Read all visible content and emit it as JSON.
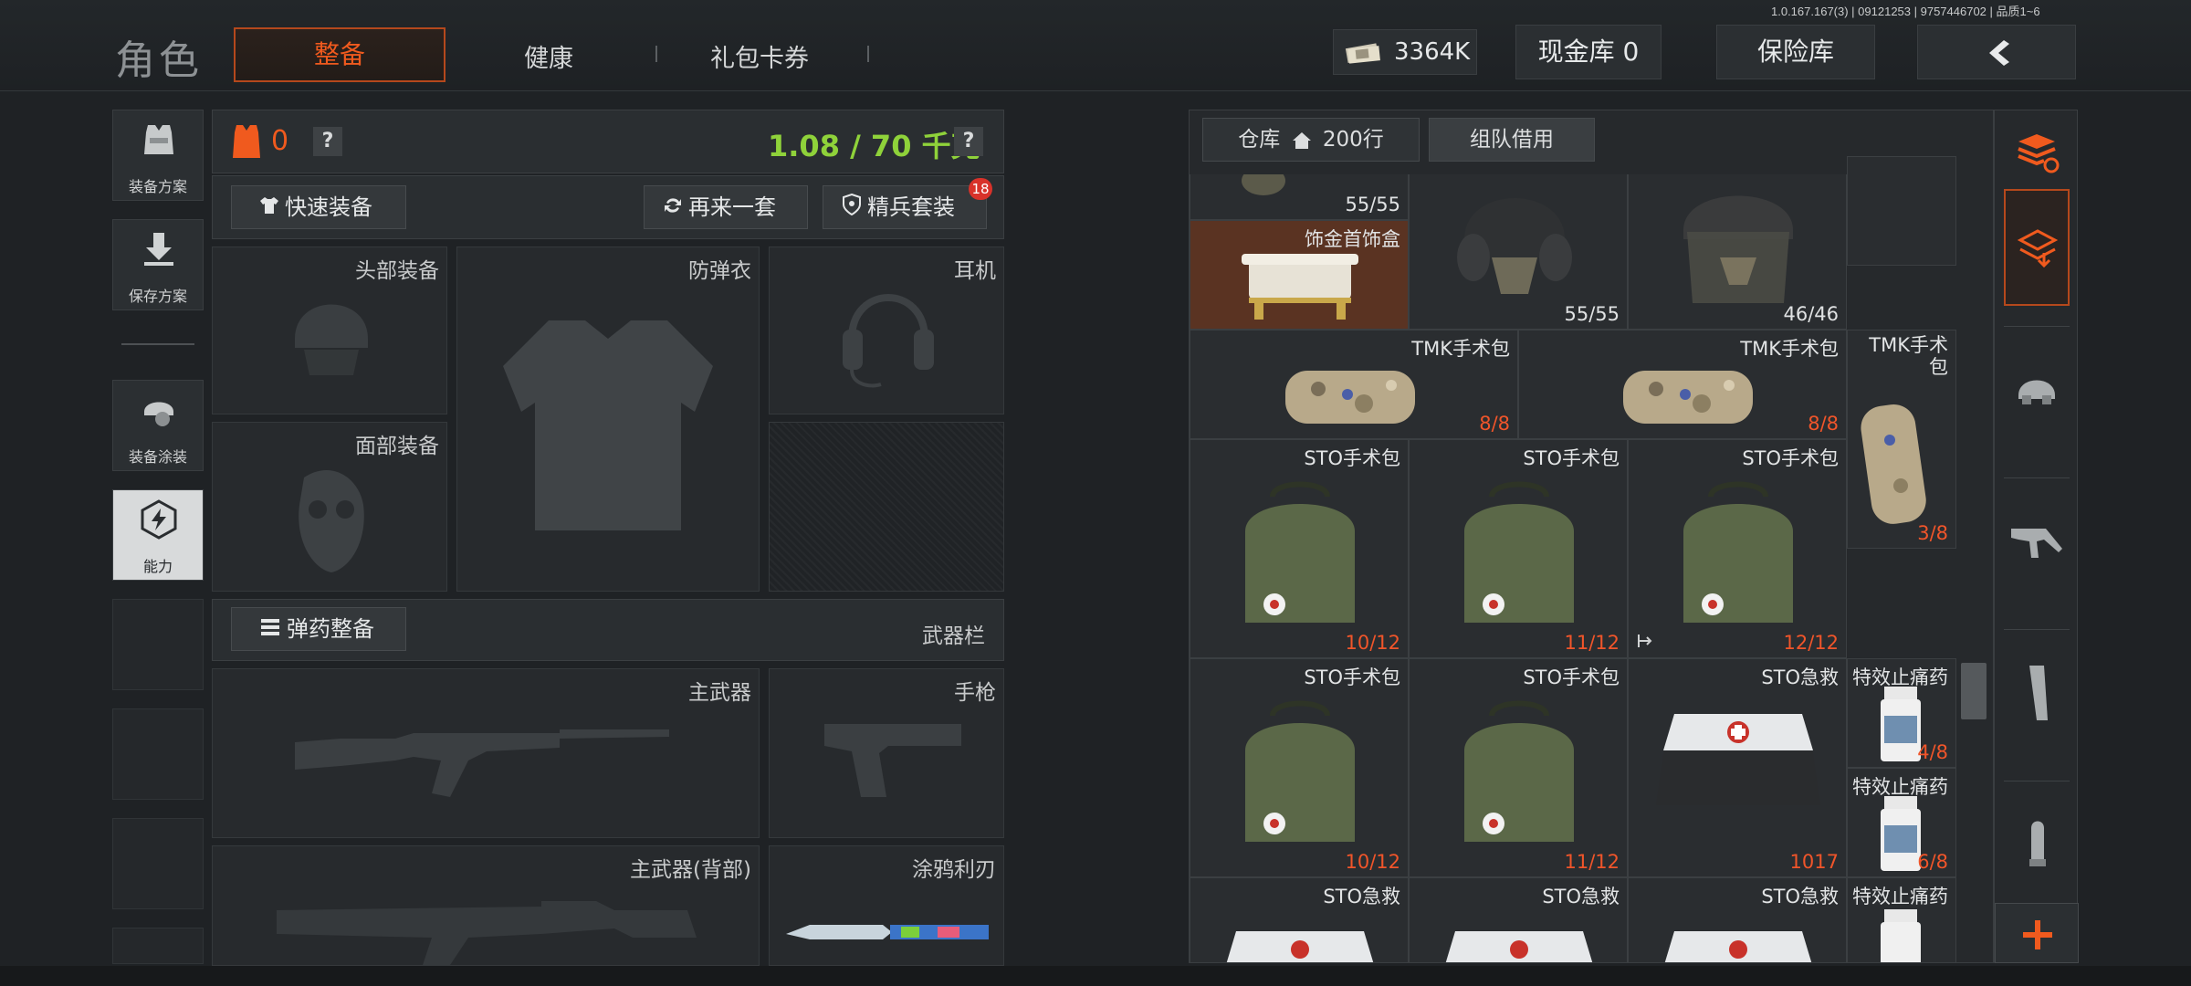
{
  "version": "1.0.167.167(3) | 09121253 | 9757446702 | 品质1~6",
  "header": {
    "title": "角色",
    "tabs": [
      "整备",
      "健康",
      "礼包卡券"
    ],
    "money": "3364K",
    "cash_vault": "现金库 0",
    "safe_vault": "保险库"
  },
  "rail": {
    "items": [
      {
        "label": "装备方案",
        "icon": "vest-icon"
      },
      {
        "label": "保存方案",
        "icon": "download-icon"
      },
      {
        "label": "装备涂装",
        "icon": "helmet-paint-icon"
      },
      {
        "label": "能力",
        "icon": "hex-bolt-icon"
      }
    ]
  },
  "equip": {
    "armor_count": "0",
    "weight": "1.08 / 70 千克",
    "quick_equip": "快速装备",
    "again": "再来一套",
    "elite": "精兵套装",
    "elite_badge": "18",
    "slots": {
      "head": "头部装备",
      "vest": "防弹衣",
      "earphone": "耳机",
      "face": "面部装备"
    },
    "ammo_btn": "弹药整备",
    "weapon_bar": "武器栏",
    "weapons": {
      "primary": "主武器",
      "pistol": "手枪",
      "primary_back": "主武器(背部)",
      "melee": "涂鸦利刃"
    }
  },
  "warehouse": {
    "tab_label": "仓库",
    "rows": "200行",
    "team_borrow": "组队借用",
    "items": [
      {
        "name": "",
        "count": "55/55",
        "red": false
      },
      {
        "name": "",
        "count": "55/55",
        "red": false
      },
      {
        "name": "",
        "count": "46/46",
        "red": false
      },
      {
        "name": "饰金首饰盒",
        "count": "",
        "red": false
      },
      {
        "name": "TMK手术包",
        "count": "8/8",
        "red": true
      },
      {
        "name": "TMK手术包",
        "count": "8/8",
        "red": true
      },
      {
        "name": "TMK手术包",
        "count": "",
        "red": false
      },
      {
        "name": "STO手术包",
        "count": "10/12",
        "red": true
      },
      {
        "name": "STO手术包",
        "count": "11/12",
        "red": true
      },
      {
        "name": "STO手术包",
        "count": "12/12",
        "red": true
      },
      {
        "name": "",
        "count": "3/8",
        "red": true
      },
      {
        "name": "STO手术包",
        "count": "10/12",
        "red": true
      },
      {
        "name": "STO手术包",
        "count": "11/12",
        "red": true
      },
      {
        "name": "STO急救",
        "count": "1017",
        "red": true
      },
      {
        "name": "特效止痛药",
        "count": "4/8",
        "red": true
      },
      {
        "name": "特效止痛药",
        "count": "6/8",
        "red": true
      },
      {
        "name": "STO急救",
        "count": "",
        "red": false
      },
      {
        "name": "STO急救",
        "count": "",
        "red": false
      },
      {
        "name": "STO急救",
        "count": "",
        "red": false
      },
      {
        "name": "特效止痛药",
        "count": "",
        "red": false
      }
    ]
  },
  "colors": {
    "accent": "#f05a1e",
    "weight_green": "#8fd23a",
    "count_red": "#f0552a"
  }
}
